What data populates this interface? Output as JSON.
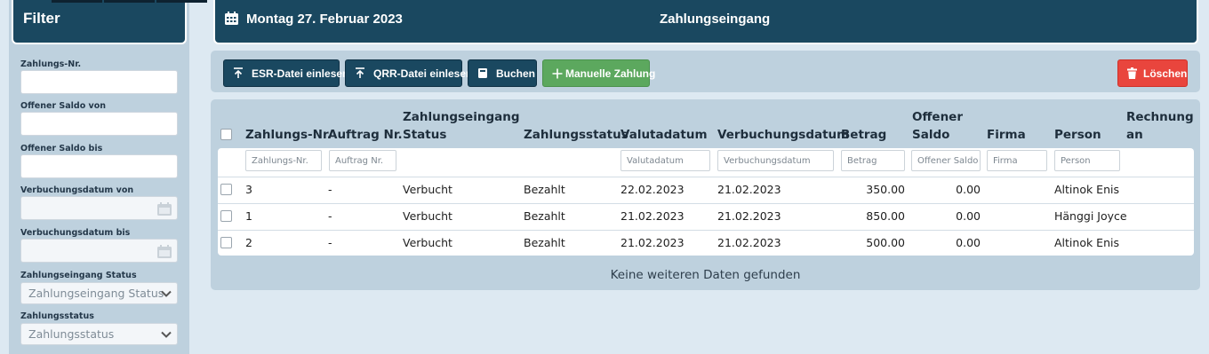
{
  "filter": {
    "title": "Filter",
    "fields": [
      {
        "label": "Zahlungs-Nr.",
        "value": ""
      },
      {
        "label": "Offener Saldo von",
        "value": ""
      },
      {
        "label": "Offener Saldo bis",
        "value": ""
      },
      {
        "label": "Verbuchungsdatum von",
        "value": ""
      },
      {
        "label": "Verbuchungsdatum bis",
        "value": ""
      }
    ],
    "selects": [
      {
        "label": "Zahlungseingang Status",
        "selected": "Zahlungseingang Status"
      },
      {
        "label": "Zahlungsstatus",
        "selected": "Zahlungsstatus"
      }
    ]
  },
  "header": {
    "date": "Montag 27. Februar 2023",
    "title": "Zahlungseingang"
  },
  "toolbar": {
    "esr_label": "ESR-Datei einlesen",
    "qrr_label": "QRR-Datei einlesen",
    "buchen_label": "Buchen",
    "manual_label": "Manuelle Zahlung",
    "delete_label": "Löschen"
  },
  "table": {
    "headers": {
      "nr": "Zahlungs-Nr.",
      "auftrag": "Auftrag Nr.",
      "eingang_status_1": "Zahlungseingang",
      "eingang_status_2": "Status",
      "zahlungsstatus": "Zahlungsstatus",
      "valuta": "Valutadatum",
      "verbuchung": "Verbuchungsdatum",
      "betrag": "Betrag",
      "saldo_1": "Offener",
      "saldo_2": "Saldo",
      "firma": "Firma",
      "person": "Person",
      "rechnung_1": "Rechnung",
      "rechnung_2": "an"
    },
    "filter_placeholders": {
      "nr": "Zahlungs-Nr.",
      "auftrag": "Auftrag Nr.",
      "valuta": "Valutadatum",
      "verbuchung": "Verbuchungsdatum",
      "betrag": "Betrag",
      "saldo": "Offener Saldo",
      "firma": "Firma",
      "person": "Person"
    },
    "rows": [
      {
        "nr": "3",
        "auftrag": "-",
        "eingang_status": "Verbucht",
        "zahlungsstatus": "Bezahlt",
        "valuta": "22.02.2023",
        "verbuchung": "21.02.2023",
        "betrag": "350.00",
        "saldo": "0.00",
        "firma": "",
        "person": "Altinok Enis"
      },
      {
        "nr": "1",
        "auftrag": "-",
        "eingang_status": "Verbucht",
        "zahlungsstatus": "Bezahlt",
        "valuta": "21.02.2023",
        "verbuchung": "21.02.2023",
        "betrag": "850.00",
        "saldo": "0.00",
        "firma": "",
        "person": "Hänggi Joyce"
      },
      {
        "nr": "2",
        "auftrag": "-",
        "eingang_status": "Verbucht",
        "zahlungsstatus": "Bezahlt",
        "valuta": "21.02.2023",
        "verbuchung": "21.02.2023",
        "betrag": "500.00",
        "saldo": "0.00",
        "firma": "",
        "person": "Altinok Enis"
      }
    ],
    "footer": "Keine weiteren Daten gefunden"
  }
}
